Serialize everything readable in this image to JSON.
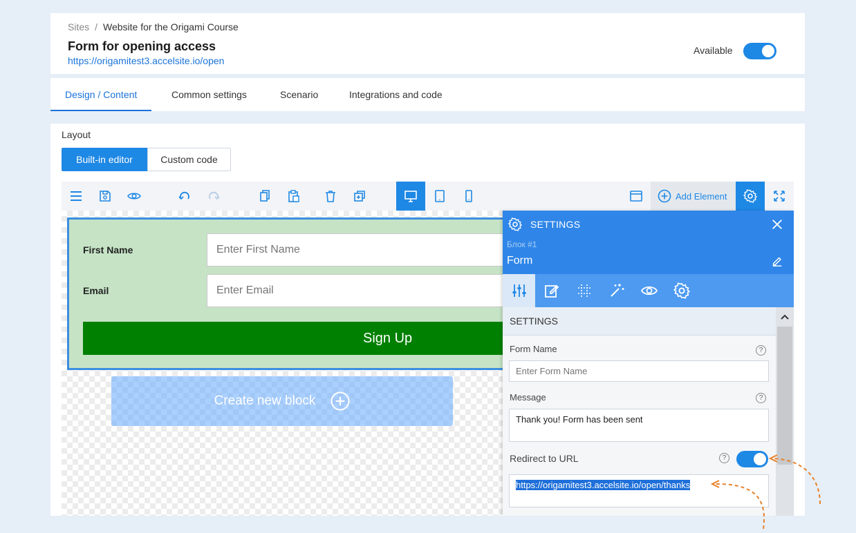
{
  "header": {
    "breadcrumb_root": "Sites",
    "breadcrumb_sep": "/",
    "breadcrumb_site": "Website for the Origami Course",
    "title": "Form for opening access",
    "url": "https://origamitest3.accelsite.io/open",
    "available_label": "Available",
    "available_on": true
  },
  "tabs": [
    {
      "label": "Design / Content",
      "active": true
    },
    {
      "label": "Common settings",
      "active": false
    },
    {
      "label": "Scenario",
      "active": false
    },
    {
      "label": "Integrations and code",
      "active": false
    }
  ],
  "layout": {
    "label": "Layout",
    "builtin_label": "Built-in editor",
    "custom_label": "Custom code",
    "selected": "Built-in editor"
  },
  "toolbar": {
    "icons": [
      "menu-icon",
      "save-icon",
      "preview-icon",
      "undo-icon",
      "redo-icon",
      "copy-icon",
      "paste-icon",
      "delete-icon",
      "duplicate-icon",
      "desktop-icon",
      "tablet-icon",
      "mobile-icon",
      "window-icon",
      "add-icon",
      "gear-icon",
      "fullscreen-icon"
    ],
    "active_device": "desktop",
    "add_element_label": "Add Element"
  },
  "form": {
    "first_name_label": "First Name",
    "first_name_placeholder": "Enter First Name",
    "email_label": "Email",
    "email_placeholder": "Enter Email",
    "submit_label": "Sign Up"
  },
  "create_block_label": "Create new block",
  "settings": {
    "title": "SETTINGS",
    "block_label": "Блок #1",
    "block_name": "Form",
    "section_title": "SETTINGS",
    "form_name_label": "Form Name",
    "form_name_placeholder": "Enter Form Name",
    "message_label": "Message",
    "message_value": "Thank you! Form has been sent",
    "redirect_label": "Redirect to URL",
    "redirect_on": true,
    "redirect_url": "https://origamitest3.accelsite.io/open/thanks",
    "help_glyph": "?"
  },
  "colors": {
    "accent": "#1e88e5",
    "panel_header": "#2f86e8",
    "form_bg": "#c6e3c6",
    "submit": "#008000",
    "annotation": "#e8822a"
  }
}
